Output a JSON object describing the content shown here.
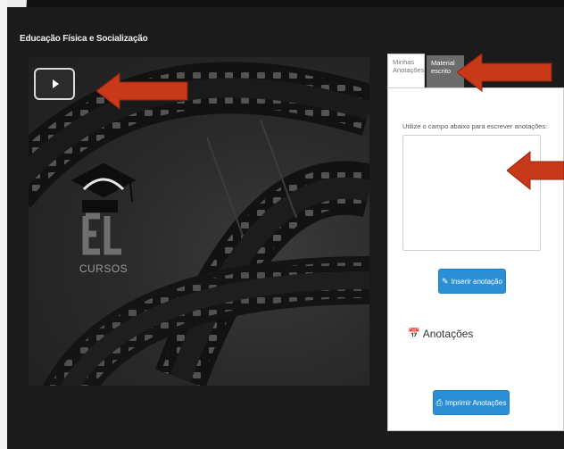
{
  "course": {
    "title": "Educação Física e Socialização"
  },
  "player": {
    "play_label": "Play",
    "logo_text": "CURSOS",
    "logo_mark": "EL"
  },
  "tabs": [
    {
      "label": "Minhas Anotações",
      "active": true
    },
    {
      "label": "Material escrito",
      "active": false
    }
  ],
  "notes": {
    "instruction": "Utilize o campo abaixo para escrever anotações:",
    "value": "",
    "insert_label": "Inserir anotação",
    "insert_icon": "pencil-icon",
    "section_title": "Anotações",
    "section_icon": "calendar-icon",
    "print_label": "Imprimir Anotações",
    "print_icon": "printer-icon"
  },
  "colors": {
    "arrow": "#c8391a",
    "button": "#2b8fd6",
    "inactive_tab": "#6c6c6c"
  }
}
